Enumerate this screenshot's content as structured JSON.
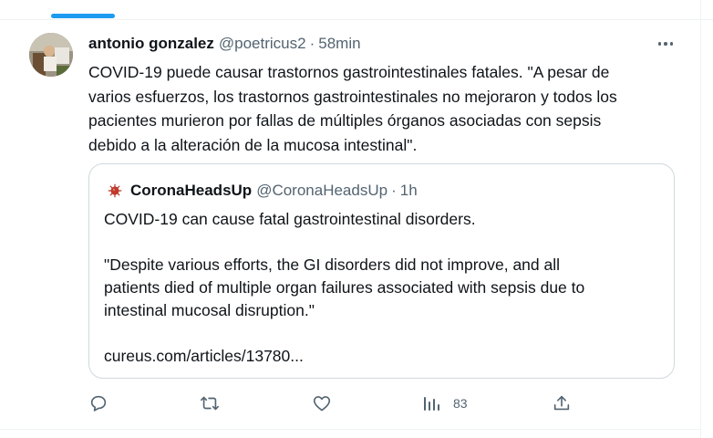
{
  "tweet": {
    "author_name": "antonio gonzalez",
    "author_handle": "@poetricus2",
    "separator": "·",
    "time": "58min",
    "text_lines": [
      "COVID-19 puede causar trastornos gastrointestinales fatales. \"A pesar de",
      "varios esfuerzos, los trastornos gastrointestinales no mejoraron y todos los",
      "pacientes murieron por fallas de múltiples órganos asociadas con sepsis",
      "debido a la alteración de la mucosa intestinal\"."
    ]
  },
  "quote": {
    "author_name": "CoronaHeadsUp",
    "author_handle": "@CoronaHeadsUp",
    "separator": "·",
    "time": "1h",
    "line1": "COVID-19 can cause fatal gastrointestinal disorders.",
    "para_lines": [
      "\"Despite various efforts, the GI disorders did not improve, and all",
      "patients died of multiple organ failures associated with sepsis due to",
      "intestinal mucosal disruption.\""
    ],
    "link": "cureus.com/articles/13780..."
  },
  "actions": {
    "views_count": "83",
    "icons": [
      "reply-icon",
      "retweet-icon",
      "like-icon",
      "views-icon",
      "share-icon",
      "more-icon"
    ]
  },
  "colors": {
    "accent": "#1d9bf0",
    "text": "#0f1419",
    "secondary": "#536471",
    "border": "#cfd9de",
    "quote_avatar": "#b5392b"
  }
}
